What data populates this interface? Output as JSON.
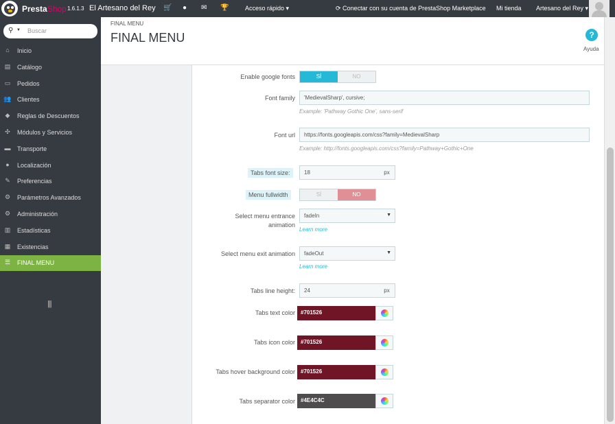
{
  "topbar": {
    "brand_presta": "Presta",
    "brand_shop": "Shop",
    "version": "1.6.1.3",
    "shop_name": "El Artesano del Rey",
    "icons": [
      "cart-icon",
      "user-icon",
      "envelope-icon",
      "trophy-icon"
    ],
    "quick_access": "Acceso rápido ▾",
    "marketplace": "Conectar con su cuenta de PrestaShop Marketplace",
    "my_store": "Mi tienda",
    "user_menu": "Artesano del Rey ▾"
  },
  "sidebar": {
    "search_placeholder": "Buscar",
    "items": [
      {
        "label": "Inicio",
        "icon": "home-icon",
        "glyph": "⌂"
      },
      {
        "label": "Catálogo",
        "icon": "book-icon",
        "glyph": "▤"
      },
      {
        "label": "Pedidos",
        "icon": "credit-card-icon",
        "glyph": "▭"
      },
      {
        "label": "Clientes",
        "icon": "users-icon",
        "glyph": "👥"
      },
      {
        "label": "Reglas de Descuentos",
        "icon": "tag-icon",
        "glyph": "◆"
      },
      {
        "label": "Módulos y Servicios",
        "icon": "puzzle-icon",
        "glyph": "✣"
      },
      {
        "label": "Transporte",
        "icon": "truck-icon",
        "glyph": "▬"
      },
      {
        "label": "Localización",
        "icon": "globe-icon",
        "glyph": "●"
      },
      {
        "label": "Preferencias",
        "icon": "wrench-icon",
        "glyph": "✎"
      },
      {
        "label": "Parámetros Avanzados",
        "icon": "cogs-icon",
        "glyph": "⚙"
      },
      {
        "label": "Administración",
        "icon": "gear-icon",
        "glyph": "⚙"
      },
      {
        "label": "Estadísticas",
        "icon": "bar-chart-icon",
        "glyph": "▥"
      },
      {
        "label": "Existencias",
        "icon": "archive-icon",
        "glyph": "▦"
      },
      {
        "label": "FINAL MENU",
        "icon": "menu-icon",
        "glyph": "☰"
      }
    ],
    "active_index": 13
  },
  "header": {
    "breadcrumb": "FINAL MENU",
    "title": "FINAL MENU",
    "help_label": "Ayuda"
  },
  "form": {
    "enable_google_fonts": {
      "label": "Enable google fonts",
      "yes": "SÍ",
      "no": "NO",
      "value": "yes"
    },
    "font_family": {
      "label": "Font family",
      "value": "'MedievalSharp', cursive;",
      "help": "Example: 'Pathway Gothic One', sans-serif"
    },
    "font_url": {
      "label": "Font url",
      "value": "https://fonts.googleapis.com/css?family=MedievalSharp",
      "help": "Example: http://fonts.googleapis.com/css?family=Pathway+Gothic+One"
    },
    "tabs_font_size": {
      "label": "Tabs font size:",
      "value": "18",
      "unit": "px"
    },
    "menu_fullwidth": {
      "label": "Menu fullwidth",
      "yes": "SÍ",
      "no": "NO",
      "value": "no"
    },
    "entrance_animation": {
      "label_line1": "Select menu entrance",
      "label_line2": "animation",
      "value": "fadeIn",
      "link": "Learn more"
    },
    "exit_animation": {
      "label": "Select menu exit animation",
      "value": "fadeOut",
      "link": "Learn more"
    },
    "tabs_line_height": {
      "label": "Tabs line height:",
      "value": "24",
      "unit": "px"
    },
    "tabs_text_color": {
      "label": "Tabs text color",
      "value": "#701526",
      "swatch": "#701526"
    },
    "tabs_icon_color": {
      "label": "Tabs icon color",
      "value": "#701526",
      "swatch": "#701526"
    },
    "tabs_hover_bg": {
      "label": "Tabs hover background color",
      "value": "#701526",
      "swatch": "#701526"
    },
    "tabs_separator_color": {
      "label": "Tabs separator color",
      "value": "#4E4C4C",
      "swatch": "#4E4C4C"
    }
  },
  "colors": {
    "accent": "#25b9d7",
    "active_nav": "#7cb342",
    "no_switch": "#e08f95"
  }
}
